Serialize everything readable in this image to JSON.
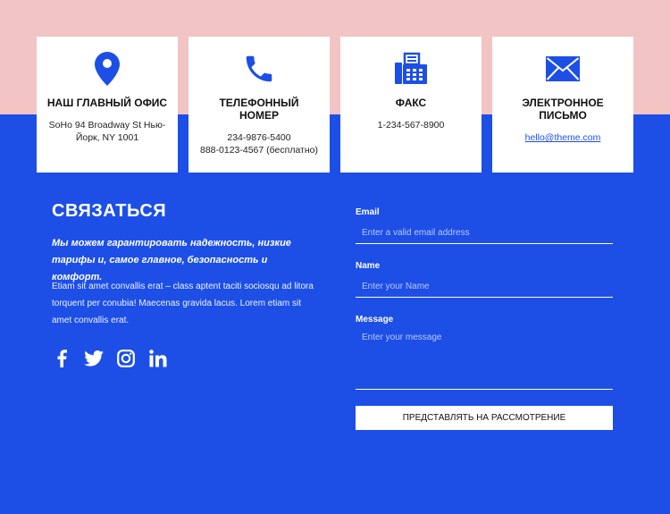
{
  "colors": {
    "accent": "#1d4fe6",
    "top_band": "#f2c4c4",
    "card": "#ffffff"
  },
  "cards": [
    {
      "icon": "map-pin-icon",
      "title": "НАШ ГЛАВНЫЙ ОФИС",
      "lines": [
        "SoHo 94 Broadway St Нью-",
        "Йорк, NY 1001"
      ]
    },
    {
      "icon": "phone-icon",
      "title_lines": [
        "ТЕЛЕФОННЫЙ",
        "НОМЕР"
      ],
      "lines": [
        "234-9876-5400",
        "888-0123-4567 (бесплатно)"
      ]
    },
    {
      "icon": "fax-icon",
      "title": "ФАКС",
      "lines": [
        "1-234-567-8900"
      ]
    },
    {
      "icon": "envelope-icon",
      "title_lines": [
        "ЭЛЕКТРОННОЕ",
        "ПИСЬМО"
      ],
      "link": "hello@theme.com"
    }
  ],
  "contact": {
    "heading": "СВЯЗАТЬСЯ",
    "lead": "Мы можем гарантировать надежность, низкие тарифы и, самое главное, безопасность и комфорт.",
    "body": "Etiam sit amet convallis erat – class aptent taciti sociosqu ad litora torquent per conubia! Maecenas gravida lacus. Lorem etiam sit amet convallis erat.",
    "socials": [
      "facebook-icon",
      "twitter-icon",
      "instagram-icon",
      "linkedin-icon"
    ]
  },
  "form": {
    "email_label": "Email",
    "email_placeholder": "Enter a valid email address",
    "name_label": "Name",
    "name_placeholder": "Enter your Name",
    "message_label": "Message",
    "message_placeholder": "Enter your message",
    "submit_label": "ПРЕДСТАВЛЯТЬ НА РАССМОТРЕНИЕ"
  }
}
